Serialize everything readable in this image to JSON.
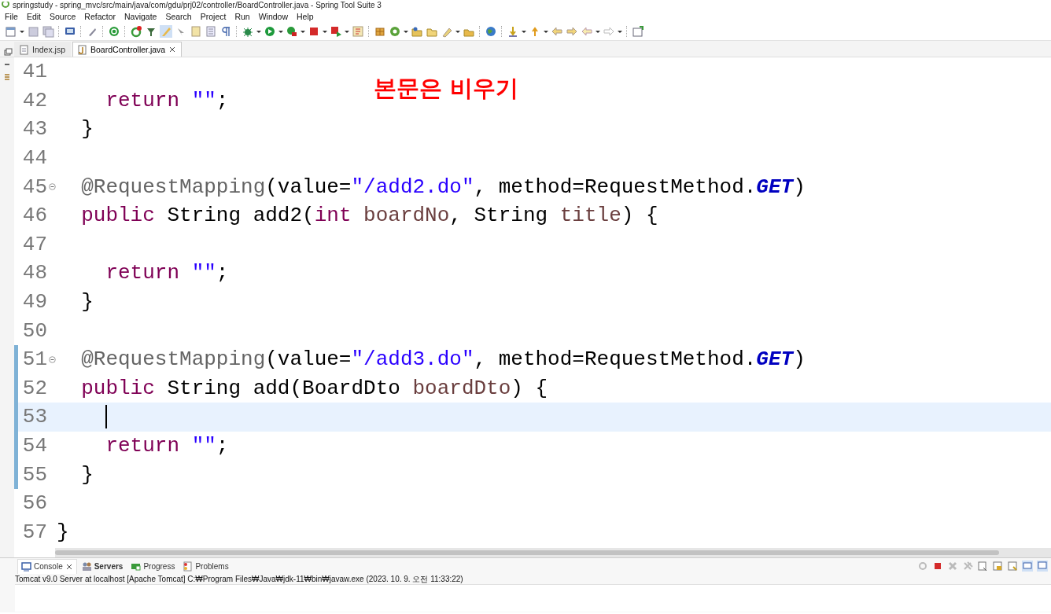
{
  "window": {
    "title": "springstudy - spring_mvc/src/main/java/com/gdu/prj02/controller/BoardController.java - Spring Tool Suite 3"
  },
  "menu": [
    "File",
    "Edit",
    "Source",
    "Refactor",
    "Navigate",
    "Search",
    "Project",
    "Run",
    "Window",
    "Help"
  ],
  "editor_tabs": [
    {
      "label": "Index.jsp",
      "selected": false,
      "closable": false
    },
    {
      "label": "BoardController.java",
      "selected": true,
      "closable": true
    }
  ],
  "overlay_caption": "본문은 비우기",
  "code_lines": [
    {
      "number": "41"
    },
    {
      "number": "42",
      "tokens": [
        {
          "kind": "keyword",
          "text": "    return"
        },
        {
          "kind": "string",
          "text": " \"\""
        },
        {
          "kind": "plain",
          "text": ";"
        }
      ]
    },
    {
      "number": "43",
      "tokens": [
        {
          "kind": "plain",
          "text": "  }"
        }
      ]
    },
    {
      "number": "44"
    },
    {
      "number": "45",
      "fold": true,
      "tokens": [
        {
          "kind": "annotation",
          "text": "  @RequestMapping"
        },
        {
          "kind": "plain",
          "text": "(value="
        },
        {
          "kind": "string",
          "text": "\"/add2.do\""
        },
        {
          "kind": "plain",
          "text": ", method=RequestMethod."
        },
        {
          "kind": "constant",
          "text": "GET"
        },
        {
          "kind": "plain",
          "text": ")"
        }
      ]
    },
    {
      "number": "46",
      "tokens": [
        {
          "kind": "keyword",
          "text": "  public"
        },
        {
          "kind": "plain",
          "text": " String add2("
        },
        {
          "kind": "keyword",
          "text": "int"
        },
        {
          "kind": "param",
          "text": " boardNo"
        },
        {
          "kind": "plain",
          "text": ", String "
        },
        {
          "kind": "param",
          "text": "title"
        },
        {
          "kind": "plain",
          "text": ") {"
        }
      ]
    },
    {
      "number": "47"
    },
    {
      "number": "48",
      "tokens": [
        {
          "kind": "keyword",
          "text": "    return"
        },
        {
          "kind": "string",
          "text": " \"\""
        },
        {
          "kind": "plain",
          "text": ";"
        }
      ]
    },
    {
      "number": "49",
      "tokens": [
        {
          "kind": "plain",
          "text": "  }"
        }
      ]
    },
    {
      "number": "50"
    },
    {
      "number": "51",
      "fold": true,
      "changed": true,
      "tokens": [
        {
          "kind": "annotation",
          "text": "  @RequestMapping"
        },
        {
          "kind": "plain",
          "text": "(value="
        },
        {
          "kind": "string",
          "text": "\"/add3.do\""
        },
        {
          "kind": "plain",
          "text": ", method=RequestMethod."
        },
        {
          "kind": "constant",
          "text": "GET"
        },
        {
          "kind": "plain",
          "text": ")"
        }
      ]
    },
    {
      "number": "52",
      "changed": true,
      "tokens": [
        {
          "kind": "keyword",
          "text": "  public"
        },
        {
          "kind": "plain",
          "text": " String add(BoardDto "
        },
        {
          "kind": "param",
          "text": "boardDto"
        },
        {
          "kind": "plain",
          "text": ") {"
        }
      ]
    },
    {
      "number": "53",
      "changed": true,
      "current": true
    },
    {
      "number": "54",
      "changed": true,
      "tokens": [
        {
          "kind": "keyword",
          "text": "    return"
        },
        {
          "kind": "string",
          "text": " \"\""
        },
        {
          "kind": "plain",
          "text": ";"
        }
      ]
    },
    {
      "number": "55",
      "changed": true,
      "tokens": [
        {
          "kind": "plain",
          "text": "  }"
        }
      ]
    },
    {
      "number": "56"
    },
    {
      "number": "57",
      "tokens": [
        {
          "kind": "plain",
          "text": "}"
        }
      ]
    }
  ],
  "bottom_tabs": [
    {
      "label": "Console",
      "selected": true,
      "closable": true,
      "bold": false
    },
    {
      "label": "Servers",
      "selected": false,
      "closable": false,
      "bold": true
    },
    {
      "label": "Progress",
      "selected": false,
      "closable": false,
      "bold": false
    },
    {
      "label": "Problems",
      "selected": false,
      "closable": false,
      "bold": false
    }
  ],
  "console": {
    "process": "Tomcat v9.0 Server at localhost [Apache Tomcat] C:₩Program Files₩Java₩jdk-11₩bin₩javaw.exe  (2023. 10. 9. 오전 11:33:22)"
  }
}
